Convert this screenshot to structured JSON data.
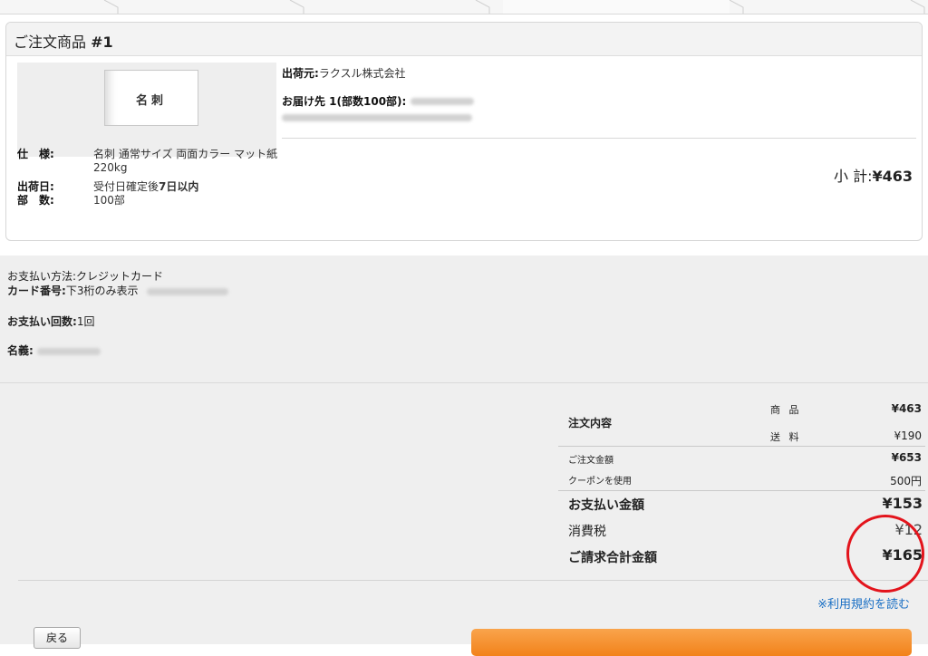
{
  "card": {
    "title_prefix": "ご注文商品 ",
    "title_number": "#1",
    "thumb_text": "名刺",
    "specs": [
      {
        "key": "仕　様:",
        "value": "名刺 通常サイズ 両面カラー マット紙\n220kg"
      },
      {
        "key": "出荷日:",
        "value_prefix": "受付日確定後",
        "value_bold": "7日以内"
      },
      {
        "key": "部　数:",
        "value": "100部"
      }
    ],
    "ship_from_label": "出荷元:",
    "ship_from_value": "ラクスル株式会社",
    "deliver_to_label": "お届け先 1(部数100部):",
    "subtotal_label": "小 計:",
    "subtotal_value": "¥463"
  },
  "payment": {
    "method_label": "お支払い方法:",
    "method_value": "クレジットカード",
    "card_label": "カード番号:",
    "card_value": "下3桁のみ表示",
    "count_label": "お支払い回数:",
    "count_value": "1回",
    "name_label": "名義:"
  },
  "totals": {
    "order_contents_label": "注文内容",
    "product_label": "商 品",
    "product_amount": "¥463",
    "shipping_label": "送 料",
    "shipping_amount": "¥190",
    "order_amount_label": "ご注文金額",
    "order_amount": "¥653",
    "coupon_label": "クーポンを使用",
    "coupon_amount": "500円",
    "payment_amount_label": "お支払い金額",
    "payment_amount": "¥153",
    "tax_label": "消費税",
    "tax_amount": "¥12",
    "grand_total_label": "ご請求合計金額",
    "grand_total": "¥165"
  },
  "terms_link_prefix": "※",
  "terms_link_text": "利用規約を読む",
  "back_button": "戻る",
  "colors": {
    "link": "#1a6fc4",
    "annotation": "#e3141c",
    "confirm_button": "#f2821a"
  }
}
